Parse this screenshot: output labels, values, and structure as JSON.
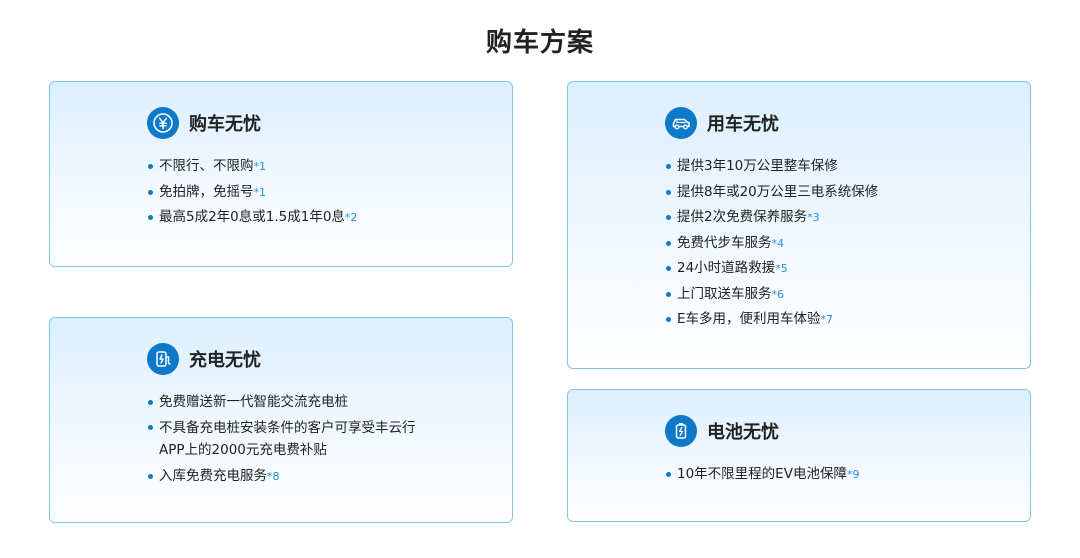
{
  "page": {
    "title": "购车方案"
  },
  "cards": {
    "buy": {
      "title": "购车无忧",
      "icon": "yen-coin-icon",
      "items": [
        {
          "text": "不限行、不限购",
          "note": "*1"
        },
        {
          "text": "免拍牌，免摇号",
          "note": "*1"
        },
        {
          "text": "最高5成2年0息或1.5成1年0息",
          "note": "*2"
        }
      ]
    },
    "use": {
      "title": "用车无忧",
      "icon": "car-icon",
      "items": [
        {
          "text": "提供3年10万公里整车保修",
          "note": ""
        },
        {
          "text": "提供8年或20万公里三电系统保修",
          "note": ""
        },
        {
          "text": "提供2次免费保养服务",
          "note": "*3"
        },
        {
          "text": "免费代步车服务",
          "note": "*4"
        },
        {
          "text": "24小时道路救援",
          "note": "*5"
        },
        {
          "text": "上门取送车服务",
          "note": "*6"
        },
        {
          "text": "E车多用，便利用车体验",
          "note": "*7"
        }
      ]
    },
    "charge": {
      "title": "充电无忧",
      "icon": "charging-plug-icon",
      "items": [
        {
          "text": "免费赠送新一代智能交流充电桩",
          "note": ""
        },
        {
          "text": "不具备充电桩安装条件的客户可享受丰云行APP上的2000元充电费补贴",
          "note": ""
        },
        {
          "text": "入库免费充电服务",
          "note": "*8"
        }
      ]
    },
    "battery": {
      "title": "电池无忧",
      "icon": "battery-icon",
      "items": [
        {
          "text": "10年不限里程的EV电池保障",
          "note": "*9"
        }
      ]
    }
  },
  "colors": {
    "accent": "#0e79c9",
    "note": "#2a8fd4",
    "border": "#7fc6e6"
  }
}
